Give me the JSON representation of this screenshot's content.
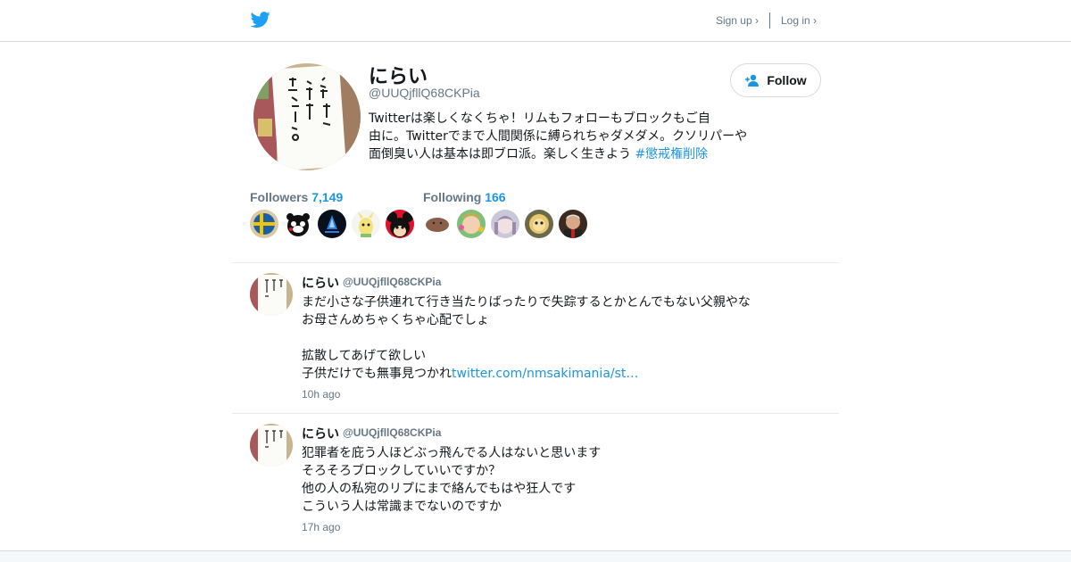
{
  "colors": {
    "accent": "#1b95e0",
    "secondary_text": "#657786",
    "bird": "#1da1f2",
    "border": "#e6ecf0"
  },
  "topbar": {
    "logo_icon": "twitter-bird-icon",
    "signup_label": "Sign up ›",
    "login_label": "Log in ›"
  },
  "profile": {
    "name": "にらい",
    "handle": "@UUQjfllQ68CKPia",
    "bio_lines": [
      "Twitterは楽しくなくちゃ！リムもフォローもブロックもご自",
      "由に。Twitterでまで人間関係に縛られちゃダメダメ。クソリパーや",
      "面倒臭い人は基本は即ブロ派。楽しく生きよう "
    ],
    "bio_hashtag": "#懲戒権削除",
    "follow_label": "Follow",
    "follow_icon": "add-user-icon"
  },
  "stats": {
    "followers_label": "Followers",
    "followers_count": "7,149",
    "following_label": "Following",
    "following_count": "166"
  },
  "tweets": [
    {
      "name": "にらい",
      "handle": "@UUQjfllQ68CKPia",
      "lines": [
        "まだ小さな子供連れて行き当たりばったりで失踪するとかとんでもない父親やな",
        "お母さんめちゃくちゃ心配でしょ",
        "",
        "拡散してあげて欲しい",
        "子供だけでも無事見つかれ"
      ],
      "link": "twitter.com/nmsakimania/st…",
      "time": "10h ago"
    },
    {
      "name": "にらい",
      "handle": "@UUQjfllQ68CKPia",
      "lines": [
        "犯罪者を庇う人ほどぶっ飛んでる人はないと思います",
        "そろそろブロックしていいですか？",
        "他の人の私宛のリプにまで絡んでもはや狂人です",
        "こういう人は常識までないのですか"
      ],
      "time": "17h ago"
    }
  ]
}
